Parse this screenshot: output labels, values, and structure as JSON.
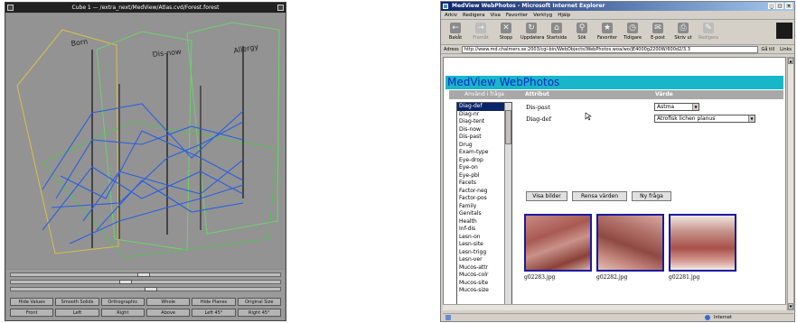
{
  "cube_window": {
    "title": "Cube 1 — /extra_next/MedView/Atlas.cvd/Forest.forest",
    "axis_labels": [
      "Born",
      "Dis-now",
      "Allergy"
    ],
    "buttons_row1": [
      "Hide Values",
      "Smooth Solids",
      "Orthographic",
      "Whole",
      "Hide Planes",
      "Original Size"
    ],
    "buttons_row2": [
      "Front",
      "Left",
      "Right",
      "Above",
      "Left 45°",
      "Right 45°"
    ]
  },
  "browser": {
    "title": "MedView WebPhotos - Microsoft Internet Explorer",
    "menu": [
      "Arkiv",
      "Redigera",
      "Visa",
      "Favoriter",
      "Verktyg",
      "Hjälp"
    ],
    "toolbar": [
      "Bakåt",
      "Framåt",
      "Stopp",
      "Uppdatera",
      "Startsida",
      "Sök",
      "Favoriter",
      "Tidigare",
      "E-post",
      "Skriv ut",
      "Redigera"
    ],
    "address_label": "Adress",
    "address": "http://www.md.chalmers.se:2003/cgi-bin/WebObjects/WebPhotos.woa/wo/jE4000g2200W/600d2/3.3",
    "go_label": "Gå till",
    "links_label": "Links",
    "status_zone": "Internet"
  },
  "page": {
    "heading": "MedView WebPhotos",
    "sidebar_heading": "Använd i fråga",
    "attr_header": "Attribut",
    "value_header": "Värde",
    "list_items": [
      "Diag-def",
      "Diag-nr",
      "Diag-tent",
      "Dis-now",
      "Dis-past",
      "Drug",
      "Exam-type",
      "Eye-drop",
      "Eye-on",
      "Eye-pbl",
      "Facets",
      "Factor-neg",
      "Factor-pos",
      "Family",
      "Genitals",
      "Health",
      "Inf-dis",
      "Lesn-on",
      "Lesn-site",
      "Lesn-trigg",
      "Lesn-ver",
      "Mucos-attr",
      "Mucos-colr",
      "Mucos-site",
      "Mucos-size"
    ],
    "selected_item": "Diag-def",
    "rows": [
      {
        "attr": "Dis-past",
        "value": "Astma"
      },
      {
        "attr": "Diag-def",
        "value": "Atrofisk lichen planus"
      }
    ],
    "buttons": [
      "Visa bilder",
      "Rensa värden",
      "Ny fråga"
    ],
    "images": [
      "g02283.jpg",
      "g02282.jpg",
      "g02281.jpg"
    ]
  }
}
